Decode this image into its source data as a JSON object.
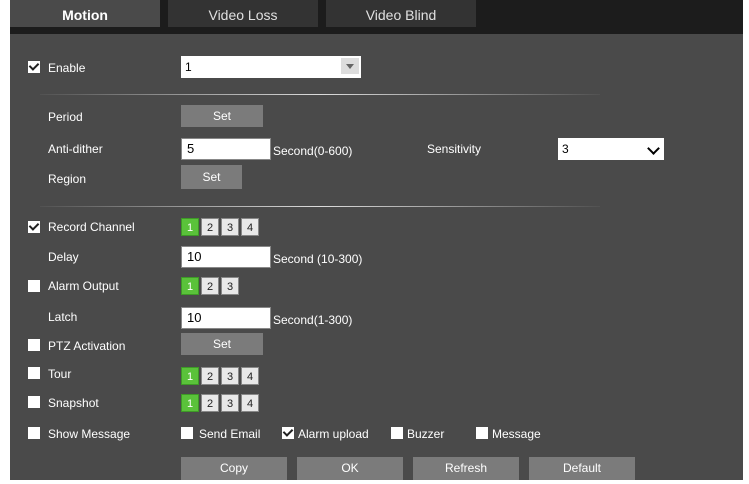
{
  "tabs": [
    {
      "label": "Motion",
      "active": true
    },
    {
      "label": "Video Loss",
      "active": false
    },
    {
      "label": "Video Blind",
      "active": false
    }
  ],
  "enable": {
    "label": "Enable",
    "checked": true,
    "channel_value": "1"
  },
  "period": {
    "label": "Period",
    "button": "Set"
  },
  "anti_dither": {
    "label": "Anti-dither",
    "value": "5",
    "unit": "Second(0-600)"
  },
  "sensitivity": {
    "label": "Sensitivity",
    "value": "3"
  },
  "region": {
    "label": "Region",
    "button": "Set"
  },
  "record_channel": {
    "label": "Record Channel",
    "checked": true,
    "channels": [
      "1",
      "2",
      "3",
      "4"
    ],
    "selected": [
      "1"
    ]
  },
  "delay": {
    "label": "Delay",
    "value": "10",
    "unit": "Second (10-300)"
  },
  "alarm_output": {
    "label": "Alarm Output",
    "checked": false,
    "channels": [
      "1",
      "2",
      "3"
    ],
    "selected": [
      "1"
    ]
  },
  "latch": {
    "label": "Latch",
    "value": "10",
    "unit": "Second(1-300)"
  },
  "ptz": {
    "label": "PTZ Activation",
    "checked": false,
    "button": "Set"
  },
  "tour": {
    "label": "Tour",
    "checked": false,
    "channels": [
      "1",
      "2",
      "3",
      "4"
    ],
    "selected": [
      "1"
    ]
  },
  "snapshot": {
    "label": "Snapshot",
    "checked": false,
    "channels": [
      "1",
      "2",
      "3",
      "4"
    ],
    "selected": [
      "1"
    ]
  },
  "show_message": {
    "label": "Show Message",
    "checked": false
  },
  "send_email": {
    "label": "Send Email",
    "checked": false
  },
  "alarm_upload": {
    "label": "Alarm upload",
    "checked": true
  },
  "buzzer": {
    "label": "Buzzer",
    "checked": false
  },
  "message": {
    "label": "Message",
    "checked": false
  },
  "footer": {
    "copy": "Copy",
    "ok": "OK",
    "refresh": "Refresh",
    "default": "Default"
  },
  "colors": {
    "panel_bg": "#4a4a4a",
    "tab_bar_bg": "#1c1c1c",
    "button_bg": "#7b7b7b",
    "channel_selected": "#5ac23a"
  }
}
